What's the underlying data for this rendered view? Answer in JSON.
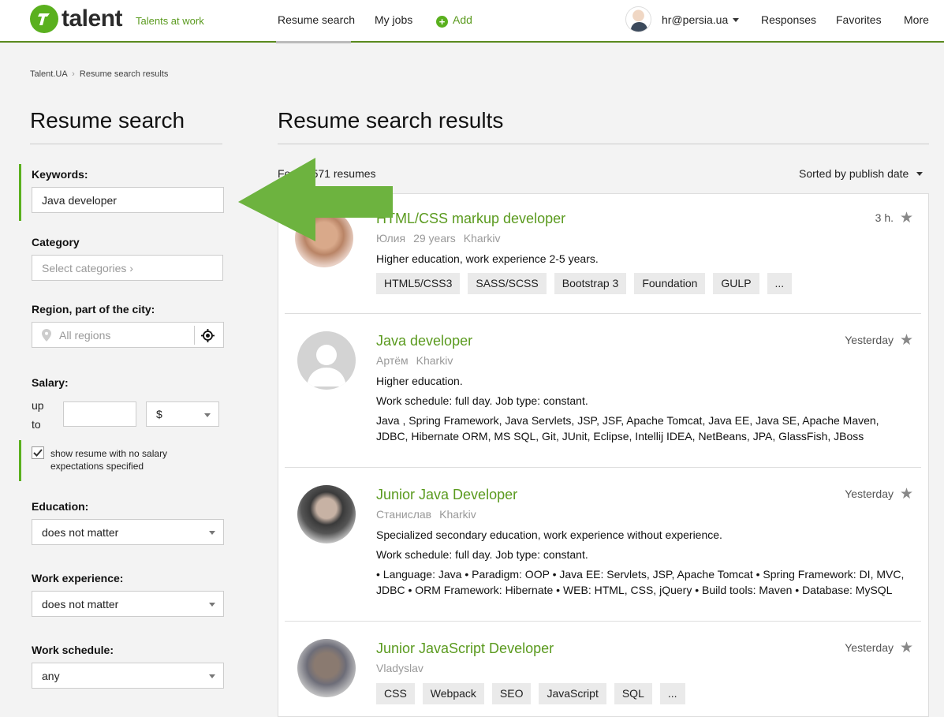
{
  "header": {
    "logo_text": "talent",
    "tagline": "Talents at work",
    "nav": {
      "resume_search": "Resume search",
      "my_jobs": "My jobs",
      "add": "Add",
      "user": "hr@persia.ua",
      "responses": "Responses",
      "favorites": "Favorites",
      "more": "More"
    }
  },
  "breadcrumb": {
    "home": "Talent.UA",
    "sep": "›",
    "current": "Resume search results"
  },
  "sidebar": {
    "title": "Resume search",
    "keywords_label": "Keywords:",
    "keywords_value": "Java developer",
    "category_label": "Category",
    "category_placeholder": "Select categories ›",
    "region_label": "Region, part of the city:",
    "region_placeholder": "All regions",
    "salary_label": "Salary:",
    "salary_up": "up",
    "salary_to": "to",
    "salary_value": "",
    "currency": "$",
    "no_salary_text": "show resume with no salary expectations specified",
    "education_label": "Education:",
    "education_value": "does not matter",
    "experience_label": "Work experience:",
    "experience_value": "does not matter",
    "schedule_label": "Work schedule:",
    "schedule_value": "any"
  },
  "main": {
    "title": "Resume search results",
    "count": "Found 571 resumes",
    "sort": "Sorted by publish date",
    "results": [
      {
        "title": "HTML/CSS markup developer",
        "name": "Юлия",
        "age": "29 years",
        "city": "Kharkiv",
        "time": "3 h.",
        "line1": "Higher  education, work experience 2-5 years.",
        "tags": [
          "HTML5/CSS3",
          "SASS/SCSS",
          "Bootstrap 3",
          "Foundation",
          "GULP",
          "..."
        ]
      },
      {
        "title": "Java developer",
        "name": "Артём",
        "city": "Kharkiv",
        "time": "Yesterday",
        "line1": "Higher  education.",
        "line2": "Work schedule: full day. Job type: constant.",
        "line3": "Java , Spring Framework, Java Servlets, JSP, JSF, Apache Tomcat, Java EE, Java SE, Apache Maven, JDBC, Hibernate ORM, MS SQL, Git, JUnit, Eclipse, Intellij IDEA, NetBeans, JPA, GlassFish, JBoss"
      },
      {
        "title": "Junior Java Developer",
        "name": "Станислав",
        "city": "Kharkiv",
        "time": "Yesterday",
        "line1": "Specialized secondary education, work experience without experience.",
        "line2": "Work schedule: full day. Job type: constant.",
        "line3": "• Language: Java • Paradigm: OOP • Java EE: Servlets, JSP, Apache Tomcat • Spring Framework: DI, MVC, JDBC • ORM Framework: Hibernate • WEB: HTML, CSS, jQuery • Build tools: Maven • Database: MySQL"
      },
      {
        "title": "Junior JavaScript Developer",
        "name": "Vladyslav",
        "time": "Yesterday",
        "tags": [
          "CSS",
          "Webpack",
          "SEO",
          "JavaScript",
          "SQL",
          "..."
        ]
      }
    ]
  },
  "colors": {
    "accent": "#5ab01e",
    "title_green": "#5a9a1e",
    "arrow": "#6db33f"
  }
}
